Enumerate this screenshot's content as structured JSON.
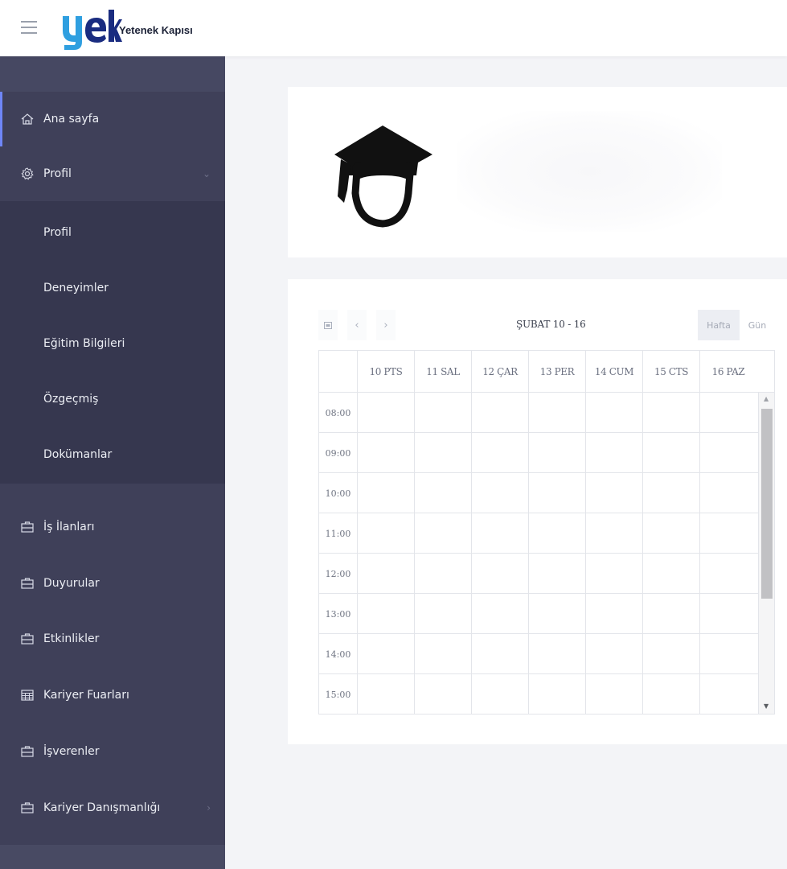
{
  "brand": {
    "name": "Yetenek Kapısı",
    "logo_letters": "yek"
  },
  "header": {
    "menu_icon": "hamburger-menu-icon"
  },
  "sidebar": {
    "items": [
      {
        "label": "Ana sayfa",
        "icon": "home-icon"
      },
      {
        "label": "Profil",
        "icon": "gear-icon"
      },
      {
        "label": "İş İlanları",
        "icon": "briefcase-icon"
      },
      {
        "label": "Duyurular",
        "icon": "briefcase-icon"
      },
      {
        "label": "Etkinlikler",
        "icon": "briefcase-icon"
      },
      {
        "label": "Kariyer Fuarları",
        "icon": "calendar-grid-icon"
      },
      {
        "label": "İşverenler",
        "icon": "briefcase-icon"
      },
      {
        "label": "Kariyer Danışmanlığı",
        "icon": "briefcase-icon"
      }
    ],
    "profile_submenu": [
      "Profil",
      "Deneyimler",
      "Eğitim Bilgileri",
      "Özgeçmiş",
      "Dokümanlar"
    ]
  },
  "profile_card": {
    "avatar_icon": "graduate-avatar-icon"
  },
  "calendar": {
    "title": "ŞUBAT 10 - 16",
    "view_week": "Hafta",
    "view_day": "Gün",
    "days": [
      "10 PTS",
      "11 SAL",
      "12 ÇAR",
      "13 PER",
      "14 CUM",
      "15 CTS",
      "16 PAZ"
    ],
    "times": [
      "08:00",
      "09:00",
      "10:00",
      "11:00",
      "12:00",
      "13:00",
      "14:00",
      "15:00"
    ]
  }
}
